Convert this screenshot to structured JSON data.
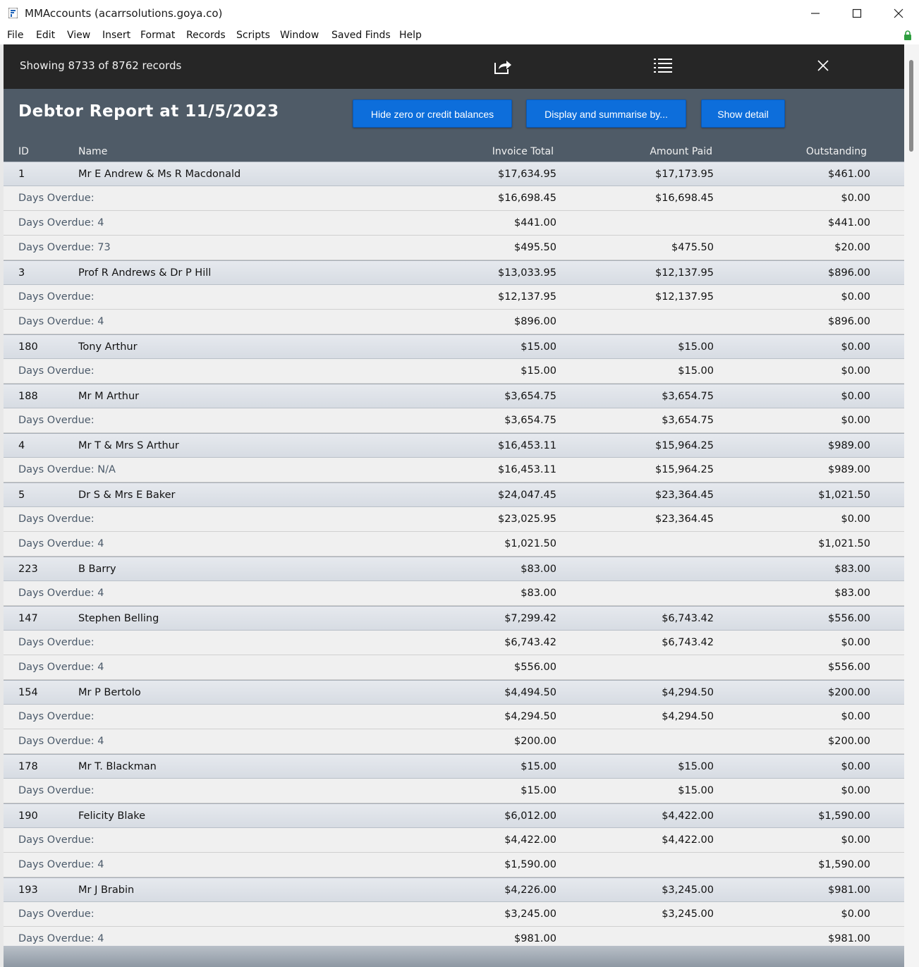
{
  "window": {
    "title": "MMAccounts (acarrsolutions.goya.co)",
    "controls": [
      "minimize",
      "maximize",
      "close"
    ]
  },
  "menu": [
    "File",
    "Edit",
    "View",
    "Insert",
    "Format",
    "Records",
    "Scripts",
    "Window",
    "Saved Finds",
    "Help"
  ],
  "toolbar": {
    "records_text": "Showing 8733 of 8762 records",
    "icons": [
      "share-export-icon",
      "list-view-icon",
      "close-icon"
    ]
  },
  "report": {
    "title": "Debtor Report at 11/5/2023",
    "buttons": {
      "hide_zero": "Hide zero or credit balances",
      "display_summarise": "Display and summarise by...",
      "show_detail": "Show detail"
    },
    "columns": {
      "id": "ID",
      "name": "Name",
      "invoice_total": "Invoice Total",
      "amount_paid": "Amount Paid",
      "outstanding": "Outstanding"
    }
  },
  "rows": [
    {
      "type": "master",
      "id": "1",
      "name": "Mr E Andrew & Ms R Macdonald",
      "inv": "$17,634.95",
      "paid": "$17,173.95",
      "out": "$461.00"
    },
    {
      "type": "detail",
      "label": "Days Overdue:",
      "inv": "$16,698.45",
      "paid": "$16,698.45",
      "out": "$0.00"
    },
    {
      "type": "detail",
      "label": "Days Overdue: 4",
      "inv": "$441.00",
      "paid": "",
      "out": "$441.00"
    },
    {
      "type": "detail",
      "label": "Days Overdue: 73",
      "inv": "$495.50",
      "paid": "$475.50",
      "out": "$20.00"
    },
    {
      "type": "master",
      "id": "3",
      "name": "Prof R Andrews & Dr P Hill",
      "inv": "$13,033.95",
      "paid": "$12,137.95",
      "out": "$896.00"
    },
    {
      "type": "detail",
      "label": "Days Overdue:",
      "inv": "$12,137.95",
      "paid": "$12,137.95",
      "out": "$0.00"
    },
    {
      "type": "detail",
      "label": "Days Overdue: 4",
      "inv": "$896.00",
      "paid": "",
      "out": "$896.00"
    },
    {
      "type": "master",
      "id": "180",
      "name": "Tony Arthur",
      "inv": "$15.00",
      "paid": "$15.00",
      "out": "$0.00"
    },
    {
      "type": "detail",
      "label": "Days Overdue:",
      "inv": "$15.00",
      "paid": "$15.00",
      "out": "$0.00"
    },
    {
      "type": "master",
      "id": "188",
      "name": "Mr M Arthur",
      "inv": "$3,654.75",
      "paid": "$3,654.75",
      "out": "$0.00"
    },
    {
      "type": "detail",
      "label": "Days Overdue:",
      "inv": "$3,654.75",
      "paid": "$3,654.75",
      "out": "$0.00"
    },
    {
      "type": "master",
      "id": "4",
      "name": "Mr T & Mrs S Arthur",
      "inv": "$16,453.11",
      "paid": "$15,964.25",
      "out": "$989.00"
    },
    {
      "type": "detail",
      "label": "Days Overdue: N/A",
      "inv": "$16,453.11",
      "paid": "$15,964.25",
      "out": "$989.00"
    },
    {
      "type": "master",
      "id": "5",
      "name": "Dr S & Mrs E Baker",
      "inv": "$24,047.45",
      "paid": "$23,364.45",
      "out": "$1,021.50"
    },
    {
      "type": "detail",
      "label": "Days Overdue:",
      "inv": "$23,025.95",
      "paid": "$23,364.45",
      "out": "$0.00"
    },
    {
      "type": "detail",
      "label": "Days Overdue: 4",
      "inv": "$1,021.50",
      "paid": "",
      "out": "$1,021.50"
    },
    {
      "type": "master",
      "id": "223",
      "name": "B Barry",
      "inv": "$83.00",
      "paid": "",
      "out": "$83.00"
    },
    {
      "type": "detail",
      "label": "Days Overdue: 4",
      "inv": "$83.00",
      "paid": "",
      "out": "$83.00"
    },
    {
      "type": "master",
      "id": "147",
      "name": "Stephen Belling",
      "inv": "$7,299.42",
      "paid": "$6,743.42",
      "out": "$556.00"
    },
    {
      "type": "detail",
      "label": "Days Overdue:",
      "inv": "$6,743.42",
      "paid": "$6,743.42",
      "out": "$0.00"
    },
    {
      "type": "detail",
      "label": "Days Overdue: 4",
      "inv": "$556.00",
      "paid": "",
      "out": "$556.00"
    },
    {
      "type": "master",
      "id": "154",
      "name": "Mr P Bertolo",
      "inv": "$4,494.50",
      "paid": "$4,294.50",
      "out": "$200.00"
    },
    {
      "type": "detail",
      "label": "Days Overdue:",
      "inv": "$4,294.50",
      "paid": "$4,294.50",
      "out": "$0.00"
    },
    {
      "type": "detail",
      "label": "Days Overdue: 4",
      "inv": "$200.00",
      "paid": "",
      "out": "$200.00"
    },
    {
      "type": "master",
      "id": "178",
      "name": "Mr T. Blackman",
      "inv": "$15.00",
      "paid": "$15.00",
      "out": "$0.00"
    },
    {
      "type": "detail",
      "label": "Days Overdue:",
      "inv": "$15.00",
      "paid": "$15.00",
      "out": "$0.00"
    },
    {
      "type": "master",
      "id": "190",
      "name": "Felicity Blake",
      "inv": "$6,012.00",
      "paid": "$4,422.00",
      "out": "$1,590.00"
    },
    {
      "type": "detail",
      "label": "Days Overdue:",
      "inv": "$4,422.00",
      "paid": "$4,422.00",
      "out": "$0.00"
    },
    {
      "type": "detail",
      "label": "Days Overdue: 4",
      "inv": "$1,590.00",
      "paid": "",
      "out": "$1,590.00"
    },
    {
      "type": "master",
      "id": "193",
      "name": "Mr J Brabin",
      "inv": "$4,226.00",
      "paid": "$3,245.00",
      "out": "$981.00"
    },
    {
      "type": "detail",
      "label": "Days Overdue:",
      "inv": "$3,245.00",
      "paid": "$3,245.00",
      "out": "$0.00"
    },
    {
      "type": "detail",
      "label": "Days Overdue: 4",
      "inv": "$981.00",
      "paid": "",
      "out": "$981.00"
    }
  ]
}
